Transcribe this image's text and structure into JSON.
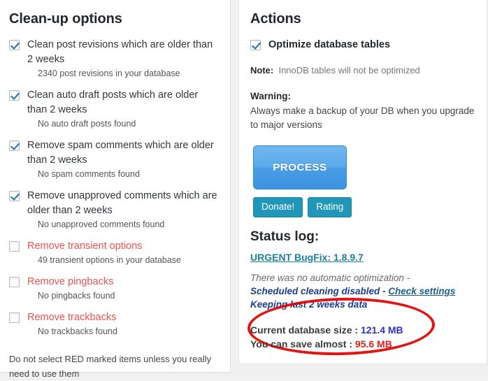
{
  "cleanup": {
    "title": "Clean-up options",
    "options": [
      {
        "checked": true,
        "danger": false,
        "label": "Clean post revisions which are older than 2 weeks",
        "note": "2340 post revisions in your database"
      },
      {
        "checked": true,
        "danger": false,
        "label": "Clean auto draft posts which are older than 2 weeks",
        "note": "No auto draft posts found"
      },
      {
        "checked": true,
        "danger": false,
        "label": "Remove spam comments which are older than 2 weeks",
        "note": "No spam comments found"
      },
      {
        "checked": true,
        "danger": false,
        "label": "Remove unapproved comments which are older than 2 weeks",
        "note": "No unapproved comments found"
      },
      {
        "checked": false,
        "danger": true,
        "label": "Remove transient options",
        "note": "49 transient options in your database"
      },
      {
        "checked": false,
        "danger": true,
        "label": "Remove pingbacks",
        "note": "No pingbacks found"
      },
      {
        "checked": false,
        "danger": true,
        "label": "Remove trackbacks",
        "note": "No trackbacks found"
      }
    ],
    "footnote": "Do not select RED marked items unless you really need to use them"
  },
  "actions": {
    "title": "Actions",
    "optimize": {
      "checked": true,
      "label": "Optimize database tables"
    },
    "note_label": "Note:",
    "note_text": "InnoDB tables will not be optimized",
    "warning_label": "Warning:",
    "warning_text": "Always make a backup of your DB when you upgrade to major versions",
    "process_button": "PROCESS",
    "donate_button": "Donate!",
    "rating_button": "Rating"
  },
  "status": {
    "title": "Status log:",
    "bugfix_link": "URGENT BugFix: 1.8.9.7",
    "line1": "There was no automatic optimization -",
    "line2_prefix": "Scheduled cleaning disabled - ",
    "line2_link": "Check settings",
    "line3": "Keeping last 2 weeks data",
    "current_size_label": "Current database size :",
    "current_size_value": "121.4 MB",
    "can_save_label": "You can save almost :",
    "can_save_value": "95.6 MB"
  },
  "colors": {
    "accent_blue": "#3d93e0",
    "teal": "#2196b9",
    "danger_red": "#e8534f",
    "highlight_red": "#e00000",
    "value_blue": "#2f2fcf",
    "value_red": "#dd2222"
  }
}
